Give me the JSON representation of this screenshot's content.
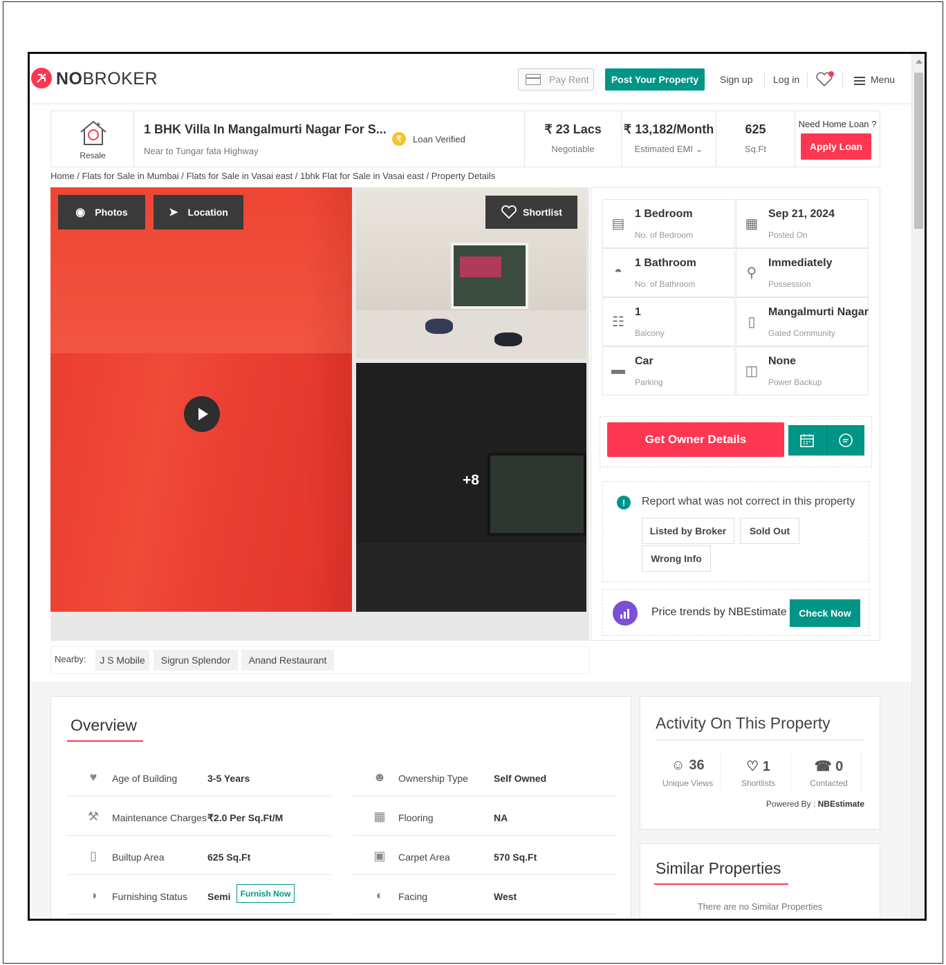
{
  "header": {
    "brand_no": "NO",
    "brand_broker": "BROKER",
    "pay_rent": "Pay Rent",
    "post_property": "Post Your Property",
    "sign_up": "Sign up",
    "log_in": "Log in",
    "menu": "Menu"
  },
  "summary": {
    "type_label": "Resale",
    "title": "1 BHK Villa In Mangalmurti Nagar For S...",
    "subtitle": "Near to Tungar fata Highway",
    "loan_verified": "Loan Verified",
    "price": "₹ 23 Lacs",
    "price_sub": "Negotiable",
    "emi": "₹ 13,182/Month",
    "emi_sub": "Estimated EMI",
    "area": "625",
    "area_sub": "Sq.Ft",
    "need_loan": "Need Home Loan ?",
    "apply_loan": "Apply Loan"
  },
  "breadcrumb": "Home / Flats for Sale in Mumbai / Flats for Sale in Vasai east / 1bhk Flat for Sale in Vasai east / Property Details",
  "gallery": {
    "photos": "Photos",
    "location": "Location",
    "shortlist": "Shortlist",
    "more_count": "+8",
    "colors": {
      "main_wall": "#ea3f33",
      "button_bg": "#3a3a3a"
    }
  },
  "details": [
    {
      "value": "1 Bedroom",
      "label": "No. of Bedroom",
      "icon": "bed-icon"
    },
    {
      "value": "Sep 21, 2024",
      "label": "Posted On",
      "icon": "calendar-icon"
    },
    {
      "value": "1 Bathroom",
      "label": "No. of Bathroom",
      "icon": "bathtub-icon"
    },
    {
      "value": "Immediately",
      "label": "Possession",
      "icon": "key-icon"
    },
    {
      "value": "1",
      "label": "Balcony",
      "icon": "balcony-icon"
    },
    {
      "value": "Mangalmurti Nagar",
      "label": "Gated Community",
      "icon": "building-icon"
    },
    {
      "value": "Car",
      "label": "Parking",
      "icon": "car-icon"
    },
    {
      "value": "None",
      "label": "Power Backup",
      "icon": "battery-icon"
    }
  ],
  "actions": {
    "owner_details": "Get Owner Details",
    "report_text": "Report what was not correct in this property",
    "tags": [
      "Listed by Broker",
      "Sold Out",
      "Wrong Info"
    ],
    "trend_text": "Price trends by NBEstimate",
    "check_now": "Check Now"
  },
  "nearby": {
    "label": "Nearby:",
    "places": [
      "J S Mobile",
      "Sigrun Splendor",
      "Anand Restaurant"
    ]
  },
  "overview": {
    "title": "Overview",
    "left": [
      {
        "label": "Age of Building",
        "value": "3-5 Years",
        "icon": "cake-icon"
      },
      {
        "label": "Maintenance Charges",
        "value": "₹2.0 Per Sq.Ft/M",
        "icon": "tools-icon"
      },
      {
        "label": "Builtup Area",
        "value": "625 Sq.Ft",
        "icon": "building-icon"
      },
      {
        "label": "Furnishing Status",
        "value": "Semi",
        "icon": "sofa-icon"
      }
    ],
    "right": [
      {
        "label": "Ownership Type",
        "value": "Self Owned",
        "icon": "person-key-icon"
      },
      {
        "label": "Flooring",
        "value": "NA",
        "icon": "tiles-icon"
      },
      {
        "label": "Carpet Area",
        "value": "570 Sq.Ft",
        "icon": "floorplan-icon"
      },
      {
        "label": "Facing",
        "value": "West",
        "icon": "compass-icon"
      }
    ],
    "furnish_now": "Furnish Now"
  },
  "activity": {
    "title": "Activity On This Property",
    "stats": [
      {
        "count": "36",
        "label": "Unique Views",
        "icon": "user-icon"
      },
      {
        "count": "1",
        "label": "Shortlists",
        "icon": "heart-icon"
      },
      {
        "count": "0",
        "label": "Contacted",
        "icon": "phone-icon"
      }
    ],
    "powered_by_label": "Powered By :",
    "powered_by": "NBEstimate"
  },
  "similar": {
    "title": "Similar Properties",
    "empty": "There are no Similar Properties"
  },
  "colors": {
    "brand_red": "#fd3752",
    "brand_green": "#009587"
  }
}
